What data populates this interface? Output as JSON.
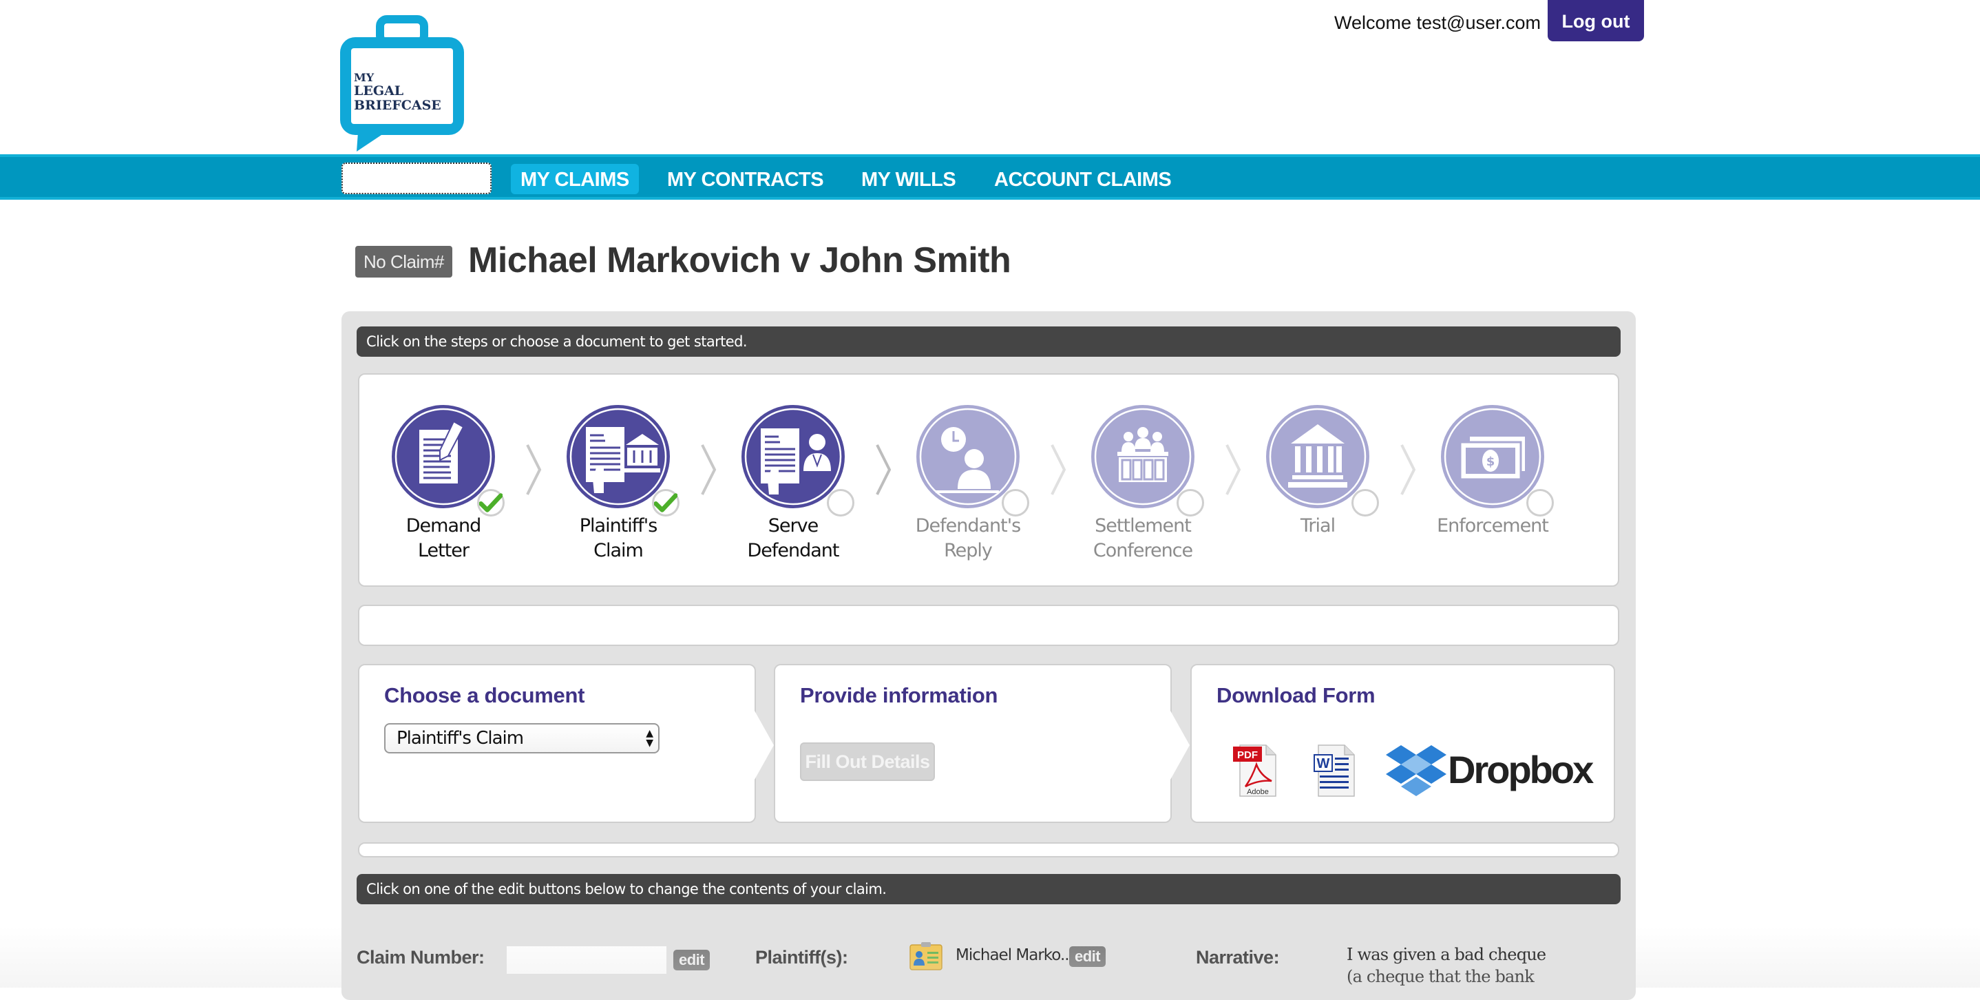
{
  "header": {
    "logo": {
      "line1": "MY",
      "line2": "LEGAL",
      "line3": "BRIEFCASE"
    },
    "welcome_text": "Welcome test@user.com",
    "logout_label": "Log out"
  },
  "nav": {
    "search_value": "",
    "items": [
      {
        "label": "MY CLAIMS",
        "active": true
      },
      {
        "label": "MY CONTRACTS",
        "active": false
      },
      {
        "label": "MY WILLS",
        "active": false
      },
      {
        "label": "ACCOUNT CLAIMS",
        "active": false
      }
    ]
  },
  "claim": {
    "number_badge": "No Claim#",
    "title": "Michael Markovich v John Smith"
  },
  "instructions": {
    "steps_hint": "Click on the steps or choose a document to get started.",
    "edit_hint": "Click on one of the edit buttons below to change the contents of your claim."
  },
  "steps": [
    {
      "line1": "Demand",
      "line2": "Letter",
      "icon": "demand-letter-icon",
      "status": "complete"
    },
    {
      "line1": "Plaintiff's",
      "line2": "Claim",
      "icon": "plaintiffs-claim-icon",
      "status": "complete"
    },
    {
      "line1": "Serve",
      "line2": "Defendant",
      "icon": "serve-defendant-icon",
      "status": "available"
    },
    {
      "line1": "Defendant's",
      "line2": "Reply",
      "icon": "defendants-reply-icon",
      "status": "locked"
    },
    {
      "line1": "Settlement",
      "line2": "Conference",
      "icon": "settlement-conference-icon",
      "status": "locked"
    },
    {
      "line1": "Trial",
      "line2": "",
      "icon": "trial-icon",
      "status": "locked"
    },
    {
      "line1": "Enforcement",
      "line2": "",
      "icon": "enforcement-icon",
      "status": "locked"
    }
  ],
  "cards": {
    "choose": {
      "heading": "Choose a document",
      "selected_document": "Plaintiff's Claim"
    },
    "provide": {
      "heading": "Provide information",
      "button_label": "Fill Out Details"
    },
    "download": {
      "heading": "Download Form",
      "formats": [
        {
          "name": "pdf-icon",
          "tag": "PDF",
          "sub": "Adobe"
        },
        {
          "name": "word-icon",
          "tag": "W"
        },
        {
          "name": "dropbox-icon",
          "label": "Dropbox"
        }
      ]
    }
  },
  "claim_fields": {
    "claim_number": {
      "label": "Claim Number:",
      "value": "",
      "edit_label": "edit"
    },
    "plaintiffs": {
      "label": "Plaintiff(s):",
      "value": "Michael Marko...",
      "edit_label": "edit"
    },
    "narrative": {
      "label": "Narrative:",
      "value": "I was given a bad cheque (a cheque that the bank"
    }
  },
  "colors": {
    "brand_teal": "#0097bf",
    "nav_active": "#10b3e1",
    "accent_purple": "#372a86",
    "step_active": "#4f4a9c",
    "step_inactive": "#a8a8d2",
    "check_green": "#4caf2a"
  }
}
